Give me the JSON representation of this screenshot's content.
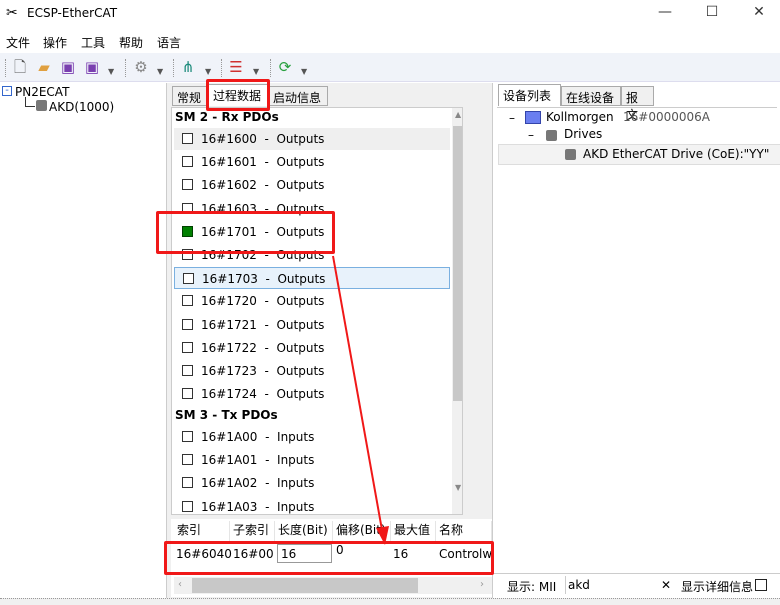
{
  "window": {
    "title": "ECSP-EtherCAT",
    "minimize": "—",
    "maximize": "☐",
    "close": "✕"
  },
  "menu": [
    "文件",
    "操作",
    "工具",
    "帮助",
    "语言"
  ],
  "toolbar": {
    "icons": [
      "new-file-icon",
      "open-folder-icon",
      "save-icon",
      "save-as-icon",
      "settings-edit-icon",
      "network-topology-icon",
      "device-config-icon",
      "refresh-icon"
    ]
  },
  "tree": {
    "root": "PN2ECAT",
    "child": "AKD(1000)"
  },
  "mid_tabs": [
    "常规",
    "过程数据",
    "启动信息"
  ],
  "pdo": {
    "sm2": "SM 2 - Rx PDOs",
    "rx": [
      {
        "idx": "16#1600",
        "dir": "Outputs",
        "on": false
      },
      {
        "idx": "16#1601",
        "dir": "Outputs",
        "on": false
      },
      {
        "idx": "16#1602",
        "dir": "Outputs",
        "on": false
      },
      {
        "idx": "16#1603",
        "dir": "Outputs",
        "on": false
      },
      {
        "idx": "16#1701",
        "dir": "Outputs",
        "on": true
      },
      {
        "idx": "16#1702",
        "dir": "Outputs",
        "on": false
      },
      {
        "idx": "16#1703",
        "dir": "Outputs",
        "on": false
      },
      {
        "idx": "16#1720",
        "dir": "Outputs",
        "on": false
      },
      {
        "idx": "16#1721",
        "dir": "Outputs",
        "on": false
      },
      {
        "idx": "16#1722",
        "dir": "Outputs",
        "on": false
      },
      {
        "idx": "16#1723",
        "dir": "Outputs",
        "on": false
      },
      {
        "idx": "16#1724",
        "dir": "Outputs",
        "on": false
      }
    ],
    "sm3": "SM 3 - Tx PDOs",
    "tx": [
      {
        "idx": "16#1A00",
        "dir": "Inputs",
        "on": false
      },
      {
        "idx": "16#1A01",
        "dir": "Inputs",
        "on": false
      },
      {
        "idx": "16#1A02",
        "dir": "Inputs",
        "on": false
      },
      {
        "idx": "16#1A03",
        "dir": "Inputs",
        "on": false
      }
    ]
  },
  "grid": {
    "headers": [
      "索引",
      "子索引",
      "长度(Bit)",
      "偏移(Bit)",
      "最大值",
      "名称"
    ],
    "row": [
      "16#6040",
      "16#00",
      "16",
      "0",
      "16",
      "Controlw"
    ]
  },
  "right_tabs": [
    "设备列表",
    "在线设备",
    "报文"
  ],
  "devices": {
    "vendor": "Kollmorgen",
    "vendor_id": "16#0000006A",
    "group": "Drives",
    "device": "AKD EtherCAT Drive (CoE):\"YY\""
  },
  "status": {
    "label": "显示: MII",
    "filter": "akd",
    "clear": "✕",
    "detail": "显示详细信息"
  },
  "colors": {
    "highlight": "#f01818",
    "checked": "#008000"
  }
}
